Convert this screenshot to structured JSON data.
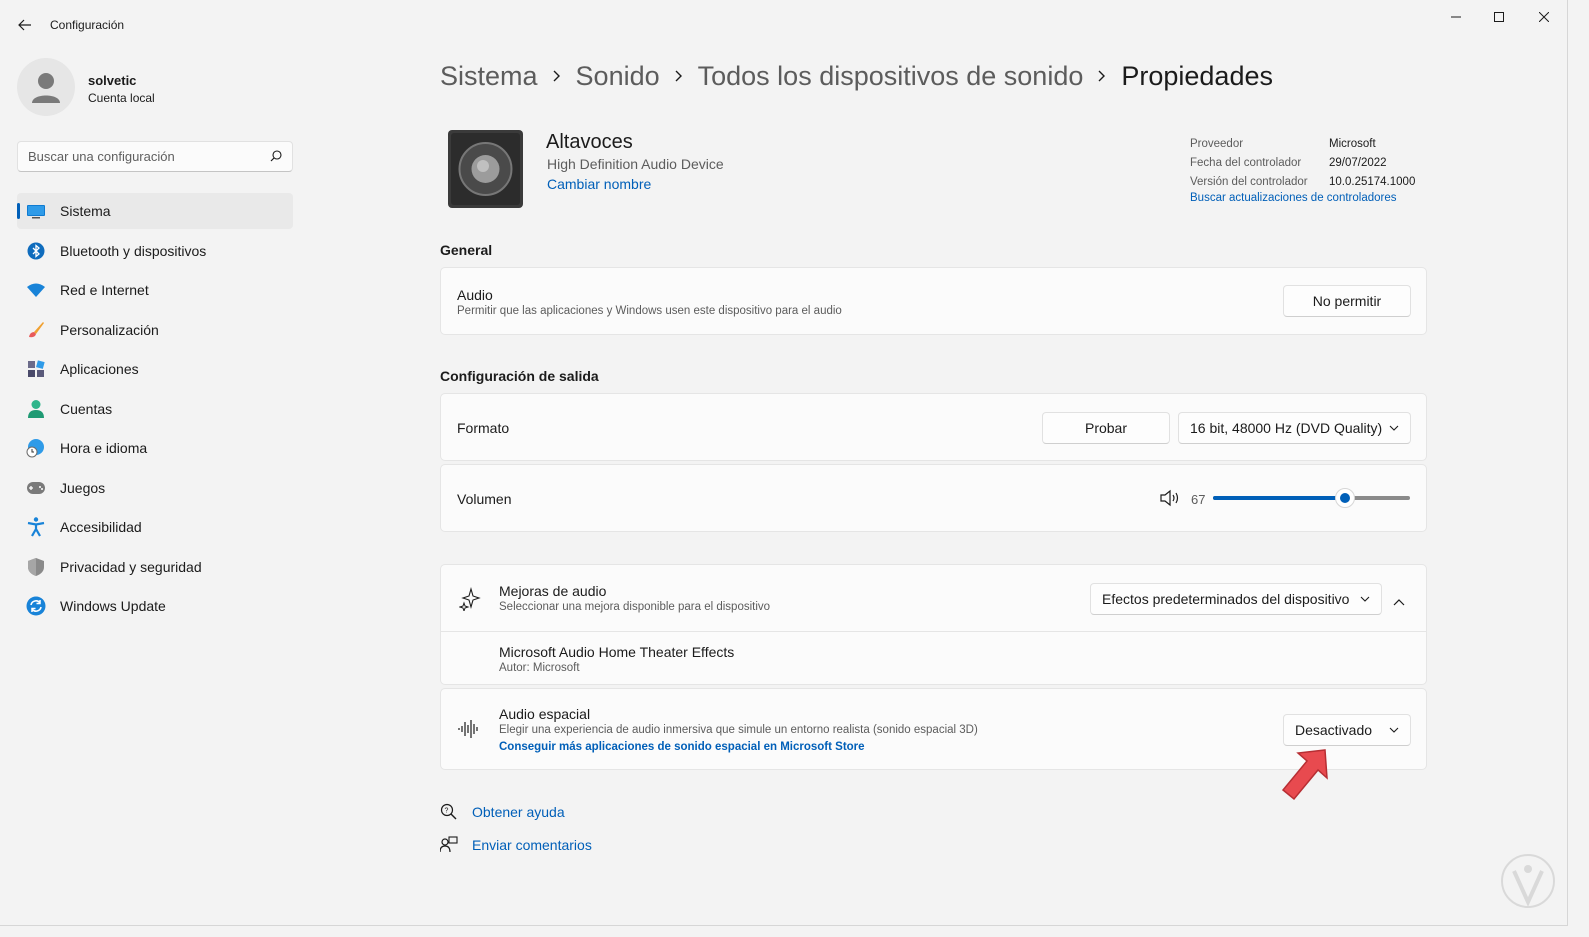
{
  "window": {
    "title": "Configuración"
  },
  "user": {
    "name": "solvetic",
    "account_type": "Cuenta local"
  },
  "search": {
    "placeholder": "Buscar una configuración"
  },
  "sidebar": {
    "items": [
      {
        "label": "Sistema"
      },
      {
        "label": "Bluetooth y dispositivos"
      },
      {
        "label": "Red e Internet"
      },
      {
        "label": "Personalización"
      },
      {
        "label": "Aplicaciones"
      },
      {
        "label": "Cuentas"
      },
      {
        "label": "Hora e idioma"
      },
      {
        "label": "Juegos"
      },
      {
        "label": "Accesibilidad"
      },
      {
        "label": "Privacidad y seguridad"
      },
      {
        "label": "Windows Update"
      }
    ]
  },
  "breadcrumb": [
    "Sistema",
    "Sonido",
    "Todos los dispositivos de sonido",
    "Propiedades"
  ],
  "device": {
    "name": "Altavoces",
    "description": "High Definition Audio Device",
    "rename_link": "Cambiar nombre"
  },
  "driver": {
    "provider_label": "Proveedor",
    "provider": "Microsoft",
    "date_label": "Fecha del controlador",
    "date": "29/07/2022",
    "version_label": "Versión del controlador",
    "version": "10.0.25174.1000",
    "update_link": "Buscar actualizaciones de controladores"
  },
  "general": {
    "title": "General",
    "audio": {
      "title": "Audio",
      "subtitle": "Permitir que las aplicaciones y Windows usen este dispositivo para el audio",
      "button": "No permitir"
    }
  },
  "output": {
    "title": "Configuración de salida",
    "format": {
      "label": "Formato",
      "test_button": "Probar",
      "selected": "16 bit, 48000 Hz (DVD Quality)"
    },
    "volume": {
      "label": "Volumen",
      "value": "67",
      "level": 0.67
    }
  },
  "enhancements": {
    "title": "Mejoras de audio",
    "subtitle": "Seleccionar una mejora disponible para el dispositivo",
    "selected": "Efectos predeterminados del dispositivo",
    "effect": {
      "name": "Microsoft Audio Home Theater Effects",
      "author": "Autor: Microsoft"
    }
  },
  "spatial": {
    "title": "Audio espacial",
    "subtitle": "Elegir una experiencia de audio inmersiva que simule un entorno realista (sonido espacial 3D)",
    "store_link": "Conseguir más aplicaciones de sonido espacial en Microsoft Store",
    "selected": "Desactivado"
  },
  "footer": {
    "help": "Obtener ayuda",
    "feedback": "Enviar comentarios"
  },
  "colors": {
    "accent": "#005fb8",
    "arrow": "#e84a4f"
  }
}
